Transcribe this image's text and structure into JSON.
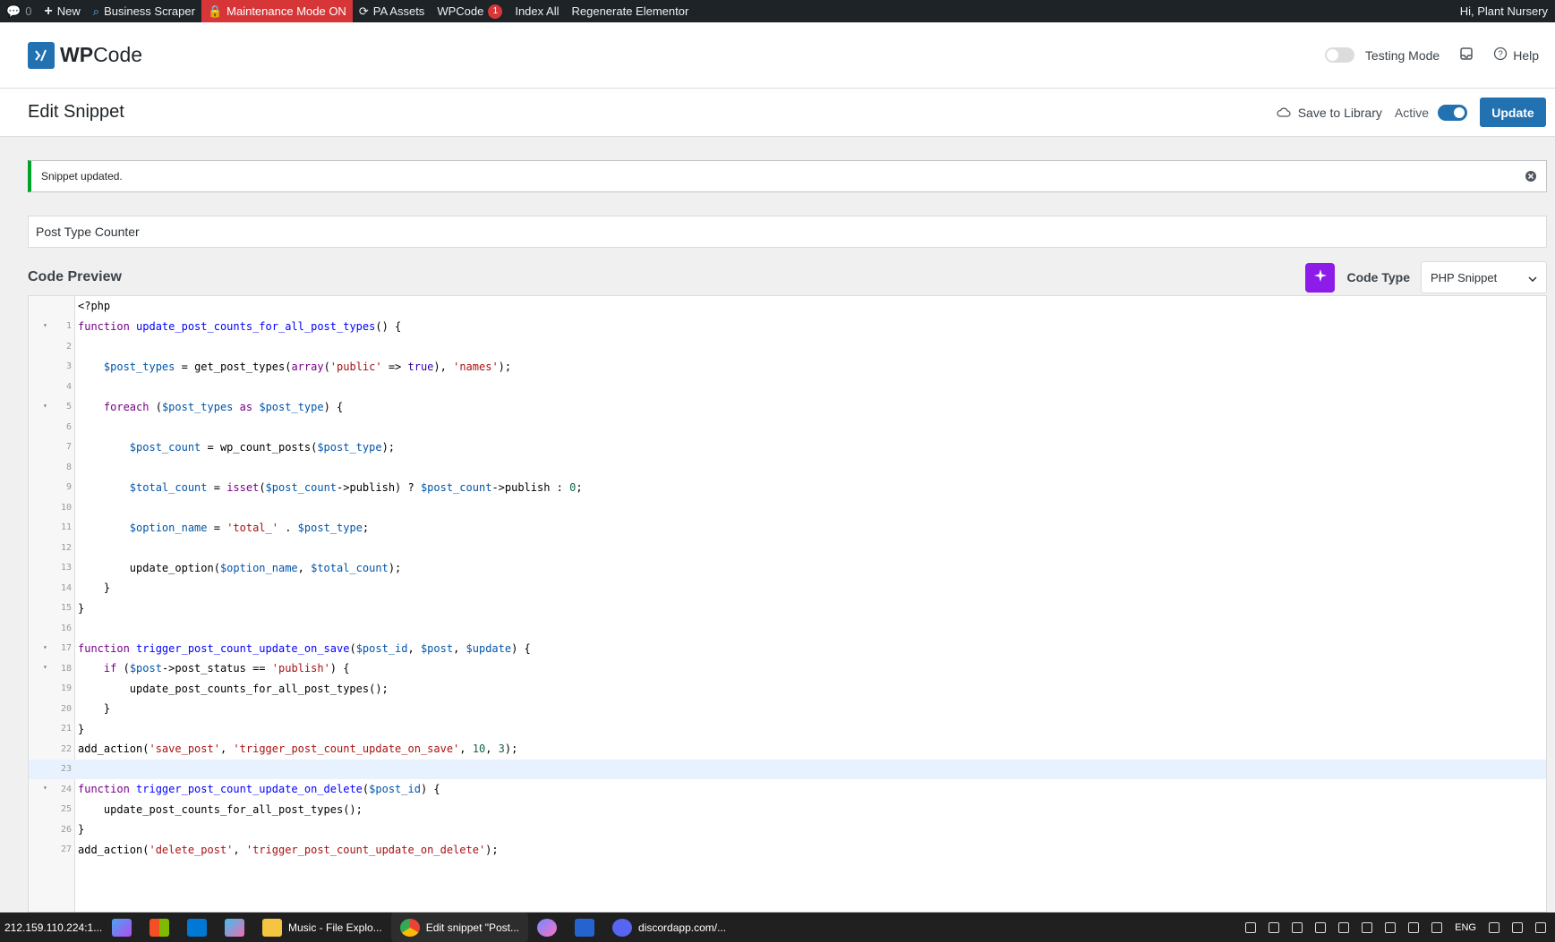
{
  "adminbar": {
    "comments_count": "0",
    "new_label": "New",
    "business_scraper": "Business Scraper",
    "maintenance": "Maintenance Mode ON",
    "pa_assets": "PA Assets",
    "wpcode": "WPCode",
    "wpcode_badge": "1",
    "index_all": "Index All",
    "regenerate": "Regenerate Elementor",
    "greeting": "Hi, Plant Nursery"
  },
  "header": {
    "logo_wp": "WP",
    "logo_code": "Code",
    "testing_mode": "Testing Mode",
    "help": "Help"
  },
  "titlebar": {
    "title": "Edit Snippet",
    "save_to_library": "Save to Library",
    "active_label": "Active",
    "update_button": "Update"
  },
  "notice": {
    "message": "Snippet updated."
  },
  "snippet": {
    "title_value": "Post Type Counter"
  },
  "code_preview": {
    "heading": "Code Preview",
    "code_type_label": "Code Type",
    "code_type_value": "PHP Snippet",
    "php_open_tag": "<?php",
    "active_line": "23",
    "lines": [
      {
        "num": "1",
        "fold": true,
        "text": "function update_post_counts_for_all_post_types() {"
      },
      {
        "num": "2",
        "fold": false,
        "text": ""
      },
      {
        "num": "3",
        "fold": false,
        "text": "    $post_types = get_post_types(array('public' => true), 'names');"
      },
      {
        "num": "4",
        "fold": false,
        "text": ""
      },
      {
        "num": "5",
        "fold": true,
        "text": "    foreach ($post_types as $post_type) {"
      },
      {
        "num": "6",
        "fold": false,
        "text": ""
      },
      {
        "num": "7",
        "fold": false,
        "text": "        $post_count = wp_count_posts($post_type);"
      },
      {
        "num": "8",
        "fold": false,
        "text": ""
      },
      {
        "num": "9",
        "fold": false,
        "text": "        $total_count = isset($post_count->publish) ? $post_count->publish : 0;"
      },
      {
        "num": "10",
        "fold": false,
        "text": ""
      },
      {
        "num": "11",
        "fold": false,
        "text": "        $option_name = 'total_' . $post_type;"
      },
      {
        "num": "12",
        "fold": false,
        "text": ""
      },
      {
        "num": "13",
        "fold": false,
        "text": "        update_option($option_name, $total_count);"
      },
      {
        "num": "14",
        "fold": false,
        "text": "    }"
      },
      {
        "num": "15",
        "fold": false,
        "text": "}"
      },
      {
        "num": "16",
        "fold": false,
        "text": ""
      },
      {
        "num": "17",
        "fold": true,
        "text": "function trigger_post_count_update_on_save($post_id, $post, $update) {"
      },
      {
        "num": "18",
        "fold": true,
        "text": "    if ($post->post_status == 'publish') {"
      },
      {
        "num": "19",
        "fold": false,
        "text": "        update_post_counts_for_all_post_types();"
      },
      {
        "num": "20",
        "fold": false,
        "text": "    }"
      },
      {
        "num": "21",
        "fold": false,
        "text": "}"
      },
      {
        "num": "22",
        "fold": false,
        "text": "add_action('save_post', 'trigger_post_count_update_on_save', 10, 3);"
      },
      {
        "num": "23",
        "fold": false,
        "text": ""
      },
      {
        "num": "24",
        "fold": true,
        "text": "function trigger_post_count_update_on_delete($post_id) {"
      },
      {
        "num": "25",
        "fold": false,
        "text": "    update_post_counts_for_all_post_types();"
      },
      {
        "num": "26",
        "fold": false,
        "text": "}"
      },
      {
        "num": "27",
        "fold": false,
        "text": "add_action('delete_post', 'trigger_post_count_update_on_delete');"
      }
    ]
  },
  "taskbar": {
    "ip": "212.159.110.224:1...",
    "music": "Music - File Explo...",
    "chrome_tab": "Edit snippet \"Post...",
    "discord": "discordapp.com/...",
    "lang": "ENG"
  },
  "colors": {
    "accent": "#2271b1",
    "maintenance": "#d63638",
    "notice_success": "#00a32a",
    "ai_button": "#8e1ce8"
  }
}
